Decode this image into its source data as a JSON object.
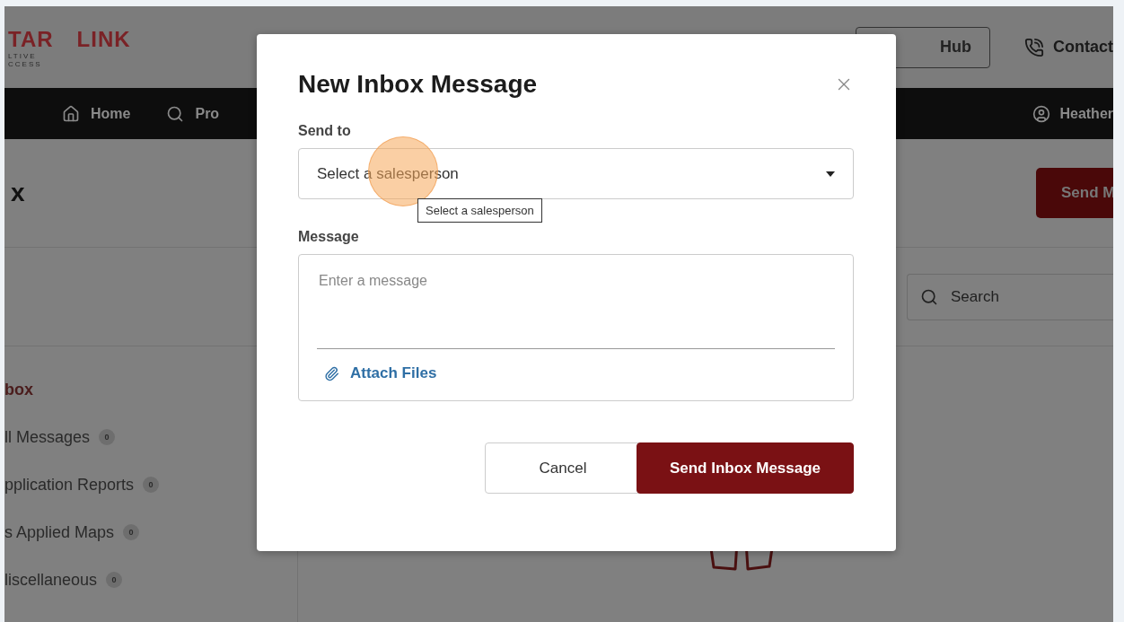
{
  "header": {
    "logo": {
      "word_1": "TAR",
      "word_2": "LINK",
      "tagline_1": "LTIVE",
      "tagline_2": "CCESS"
    },
    "hub_button": "Hub",
    "contact": "Contact"
  },
  "nav": {
    "items": [
      {
        "label": "Home"
      },
      {
        "label": "Pro"
      }
    ],
    "user": "Heather"
  },
  "page": {
    "title": "x",
    "send_button": "Send M",
    "search": {
      "placeholder": "Search"
    }
  },
  "sidebar": {
    "items": [
      {
        "label": "box",
        "selected": true
      },
      {
        "label": "ll Messages",
        "count": "0",
        "selected": false
      },
      {
        "label": "pplication Reports",
        "count": "0",
        "selected": false
      },
      {
        "label": "s Applied Maps",
        "count": "0",
        "selected": false
      },
      {
        "label": "liscellaneous",
        "count": "0",
        "selected": false
      }
    ]
  },
  "modal": {
    "title": "New Inbox Message",
    "send_to_label": "Send to",
    "select": {
      "placeholder": "Select a salesperson"
    },
    "tooltip": "Select a salesperson",
    "message_label": "Message",
    "message": {
      "placeholder": "Enter a message"
    },
    "attach": "Attach Files",
    "buttons": [
      {
        "label": "Cancel",
        "kind": "secondary"
      },
      {
        "label": "Send Inbox Message",
        "kind": "primary"
      }
    ]
  }
}
